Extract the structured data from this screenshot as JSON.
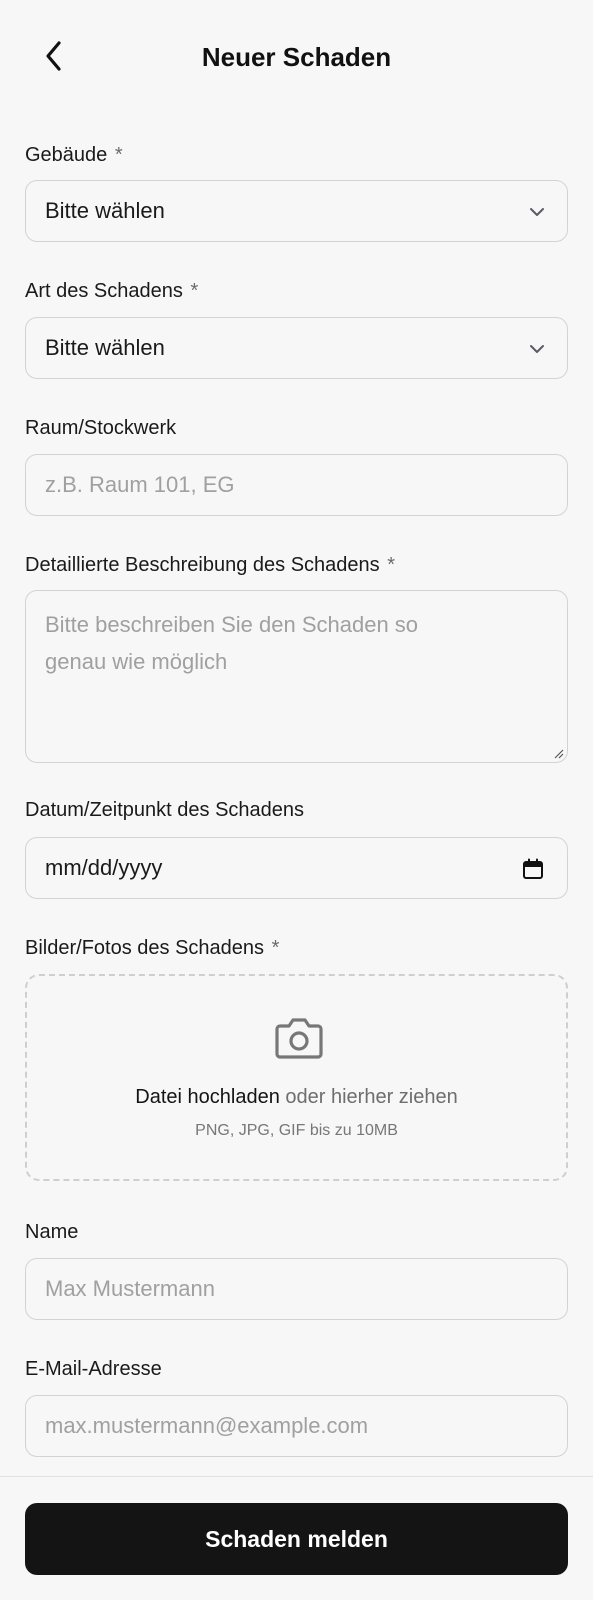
{
  "header": {
    "title": "Neuer Schaden"
  },
  "form": {
    "building": {
      "label": "Gebäude",
      "required": "*",
      "value": "Bitte wählen"
    },
    "damage_type": {
      "label": "Art des Schadens",
      "required": "*",
      "value": "Bitte wählen"
    },
    "room": {
      "label": "Raum/Stockwerk",
      "placeholder": "z.B. Raum 101, EG"
    },
    "description": {
      "label": "Detaillierte Beschreibung des Schadens",
      "required": "*",
      "placeholder_line1": "Bitte beschreiben Sie den Schaden so",
      "placeholder_line2": "genau wie möglich"
    },
    "date": {
      "label": "Datum/Zeitpunkt des Schadens",
      "value": "mm/dd/yyyy"
    },
    "photos": {
      "label": "Bilder/Fotos des Schadens",
      "required": "*",
      "upload_link": "Datei hochladen",
      "upload_rest": "oder hierher ziehen",
      "hint": "PNG, JPG, GIF bis zu 10MB"
    },
    "name": {
      "label": "Name",
      "placeholder": "Max Mustermann"
    },
    "email": {
      "label": "E-Mail-Adresse",
      "placeholder": "max.mustermann@example.com"
    }
  },
  "footer": {
    "submit_label": "Schaden melden"
  },
  "icons": {
    "back": "chevron-left-icon",
    "select": "chevron-down-icon",
    "date": "calendar-icon",
    "upload": "camera-icon"
  },
  "colors": {
    "background": "#f7f7f7",
    "primary_button": "#141414",
    "border": "#d3d3d3",
    "placeholder": "#a0a0a0"
  }
}
